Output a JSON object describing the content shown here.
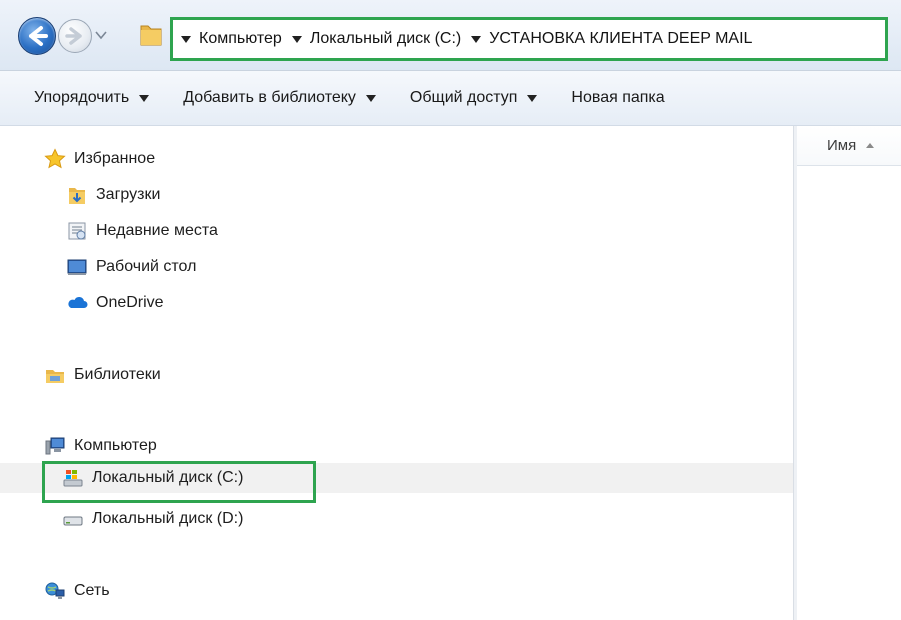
{
  "address": {
    "breadcrumbs": [
      "Компьютер",
      "Локальный диск (C:)",
      "УСТАНОВКА КЛИЕНТА DEEP MAIL"
    ]
  },
  "toolbar": {
    "organize": "Упорядочить",
    "add_to_library": "Добавить в библиотеку",
    "share": "Общий доступ",
    "new_folder": "Новая папка"
  },
  "nav": {
    "favorites": "Избранное",
    "downloads": "Загрузки",
    "recent_places": "Недавние места",
    "desktop": "Рабочий стол",
    "onedrive": "OneDrive",
    "libraries": "Библиотеки",
    "computer": "Компьютер",
    "local_disk_c": "Локальный диск (C:)",
    "local_disk_d": "Локальный диск (D:)",
    "network": "Сеть"
  },
  "content": {
    "name_column": "Имя"
  },
  "colors": {
    "highlight": "#2ea44f",
    "selected_row": "#f1f1f1"
  }
}
